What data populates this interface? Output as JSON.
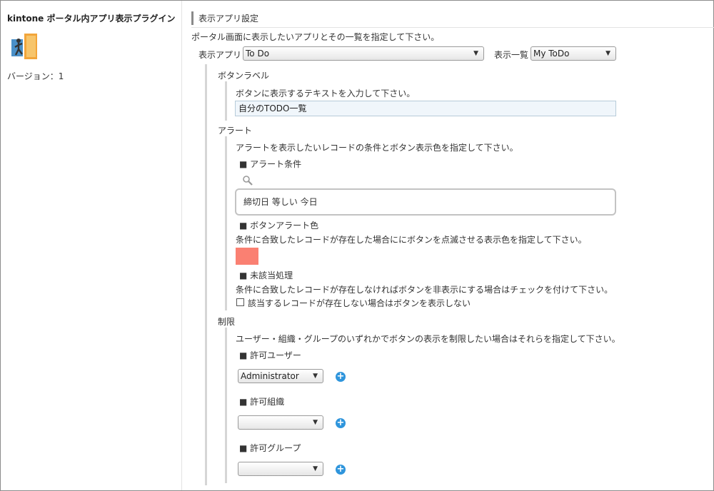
{
  "sidebar": {
    "title": "kintone ポータル内アプリ表示プラグイン",
    "version": "バージョン：1"
  },
  "header": {
    "title": "表示アプリ設定",
    "description": "ポータル画面に表示したいアプリとその一覧を指定して下さい。"
  },
  "app_select": {
    "label": "表示アプリ",
    "value": "To Do"
  },
  "list_select": {
    "label": "表示一覧",
    "value": "My ToDo"
  },
  "button_label": {
    "heading": "ボタンラベル",
    "description": "ボタンに表示するテキストを入力して下さい。",
    "value": "自分のTODO一覧"
  },
  "alert": {
    "heading": "アラート",
    "description": "アラートを表示したいレコードの条件とボタン表示色を指定して下さい。",
    "condition_heading": "■ アラート条件",
    "condition_text": "締切日  等しい  今日",
    "color_heading": "■ ボタンアラート色",
    "color_description": "条件に合致したレコードが存在した場合ににボタンを点滅させる表示色を指定して下さい。",
    "color_value": "#fa8072",
    "unmatched_heading": "■ 未該当処理",
    "unmatched_description": "条件に合致したレコードが存在しなければボタンを非表示にする場合はチェックを付けて下さい。",
    "hide_checkbox_label": "該当するレコードが存在しない場合はボタンを表示しない",
    "hide_checked": false
  },
  "restriction": {
    "heading": "制限",
    "description": "ユーザー・組織・グループのいずれかでボタンの表示を制限したい場合はそれらを指定して下さい。",
    "user_heading": "■ 許可ユーザー",
    "user_value": "Administrator",
    "org_heading": "■ 許可組織",
    "org_value": "",
    "group_heading": "■ 許可グループ",
    "group_value": ""
  },
  "icons": {
    "dropdown": "▼",
    "plus": "+",
    "search": "search-icon",
    "plugin": "door-exit-icon"
  }
}
